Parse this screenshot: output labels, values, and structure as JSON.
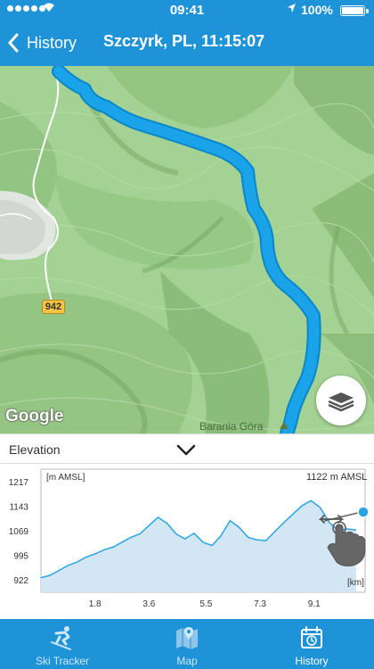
{
  "status_bar": {
    "time": "09:41",
    "battery": "100%"
  },
  "nav": {
    "back_label": "History",
    "title": "Szczyrk, PL, 11:15:07"
  },
  "map": {
    "road_number": "942",
    "attribution": "Google",
    "peak_label": "Barania Góra",
    "layers_icon": "layers-icon"
  },
  "elevation": {
    "section_title": "Elevation",
    "toggle_icon": "chevron-down-icon",
    "chart_data": {
      "type": "area",
      "ylabel": "[m AMSL]",
      "xlabel": "[km]",
      "yticks": [
        "1217",
        "1143",
        "1069",
        "995",
        "922"
      ],
      "xticks": [
        "1.8",
        "3.6",
        "5.5",
        "7.3",
        "9.1"
      ],
      "ylim": [
        884,
        1255
      ],
      "xlim": [
        0,
        10.8
      ],
      "max_label": "1122 m AMSL",
      "line_color": "#2aa5e2",
      "series": [
        {
          "x": [
            0.0,
            0.3,
            0.6,
            0.9,
            1.2,
            1.5,
            1.8,
            2.1,
            2.4,
            2.7,
            3.0,
            3.3,
            3.6,
            3.9,
            4.2,
            4.5,
            4.8,
            5.1,
            5.4,
            5.7,
            6.0,
            6.3,
            6.6,
            6.9,
            7.2,
            7.5,
            7.8,
            8.1,
            8.4,
            8.7,
            9.0,
            9.3,
            9.6,
            9.9,
            10.2,
            10.5
          ],
          "y": [
            928,
            935,
            950,
            965,
            975,
            990,
            1000,
            1012,
            1020,
            1035,
            1050,
            1060,
            1085,
            1110,
            1092,
            1060,
            1045,
            1062,
            1035,
            1025,
            1055,
            1100,
            1080,
            1050,
            1042,
            1040,
            1068,
            1095,
            1120,
            1145,
            1160,
            1140,
            1095,
            1070,
            1075,
            1072
          ]
        }
      ]
    }
  },
  "tabbar": {
    "tabs": [
      {
        "label": "Ski Tracker",
        "icon": "skier-icon",
        "active": false
      },
      {
        "label": "Map",
        "icon": "map-pin-icon",
        "active": false
      },
      {
        "label": "History",
        "icon": "calendar-clock-icon",
        "active": true
      }
    ]
  },
  "colors": {
    "brand": "#1f93d8",
    "route": "#1aa3e8",
    "map_green": "#9fcf8e"
  }
}
